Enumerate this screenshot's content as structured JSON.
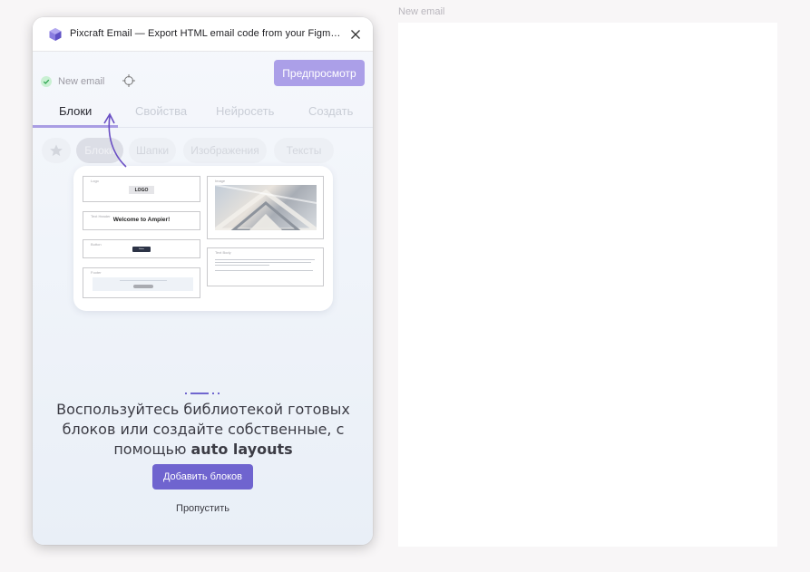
{
  "canvas": {
    "frame_label": "New email"
  },
  "plugin": {
    "title": "Pixcraft Email — Export HTML email code from your Figma...",
    "status_text": "New email",
    "preview_button": "Предпросмотр",
    "tabs": [
      {
        "label": "Блоки"
      },
      {
        "label": "Свойства"
      },
      {
        "label": "Нейросеть"
      },
      {
        "label": "Создать"
      }
    ],
    "chips": [
      {
        "label": "Блоки"
      },
      {
        "label": "Шапки"
      },
      {
        "label": "Изображения"
      },
      {
        "label": "Тексты"
      }
    ],
    "preview_card": {
      "logo_label": "Logo",
      "logo_text": "LOGO",
      "header_label": "Text Header",
      "header_text": "Welcome to Ampier!",
      "button_label": "Button",
      "button_text": "Button",
      "footer_label": "Footer",
      "image_label": "Image",
      "body_label": "Text Body"
    },
    "onboarding": {
      "text_before": "Воспользуйтесь библиотекой готовых блоков или создайте собственные, с помощью ",
      "text_bold": "auto layouts",
      "add_button": "Добавить блоков",
      "skip_link": "Пропустить"
    }
  },
  "colors": {
    "accent": "#6f64cf",
    "accent_light": "#ab9fe8",
    "success": "#5cc87a"
  },
  "icons": {
    "logo": "pixcraft-cube-icon",
    "close": "close-icon",
    "status": "check-circle-icon",
    "target": "crosshair-icon",
    "favorites": "star-icon"
  }
}
